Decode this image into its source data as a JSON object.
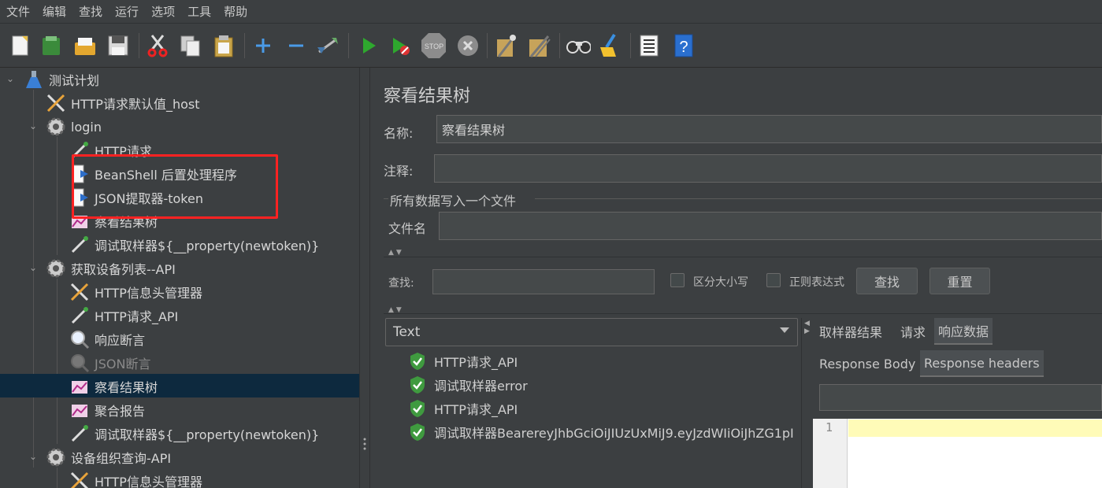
{
  "menu": [
    "文件",
    "编辑",
    "查找",
    "运行",
    "选项",
    "工具",
    "帮助"
  ],
  "toolbar_icons": [
    "new-icon",
    "templates-icon",
    "open-icon",
    "save-icon",
    "cut-icon",
    "copy-icon",
    "paste-icon",
    "expand-icon",
    "collapse-icon",
    "toggle-icon",
    "start-icon",
    "start-no-pause-icon",
    "stop-icon",
    "shutdown-icon",
    "clear-icon",
    "clear-all-icon",
    "search-icon",
    "reset-search-icon",
    "function-helper-icon",
    "help-icon"
  ],
  "tree": {
    "nodes": [
      {
        "label": "测试计划"
      },
      {
        "label": "HTTP请求默认值_host"
      },
      {
        "label": "login"
      },
      {
        "label": "HTTP请求"
      },
      {
        "label": "BeanShell 后置处理程序"
      },
      {
        "label": "JSON提取器-token"
      },
      {
        "label": "察看结果树"
      },
      {
        "label": "调试取样器${__property(newtoken)}"
      },
      {
        "label": "获取设备列表--API"
      },
      {
        "label": "HTTP信息头管理器"
      },
      {
        "label": "HTTP请求_API"
      },
      {
        "label": "响应断言"
      },
      {
        "label": "JSON断言"
      },
      {
        "label": "察看结果树"
      },
      {
        "label": "聚合报告"
      },
      {
        "label": "调试取样器${__property(newtoken)}"
      },
      {
        "label": "设备组织查询-API"
      },
      {
        "label": "HTTP信息头管理器"
      }
    ]
  },
  "panel": {
    "title": "察看结果树",
    "name_label": "名称:",
    "name_value": "察看结果树",
    "comment_label": "注释:",
    "comment_value": "",
    "file_group": "所有数据写入一个文件",
    "filename_label": "文件名",
    "filename_value": "",
    "search_label": "查找:",
    "search_value": "",
    "case_label": "区分大小写",
    "regex_label": "正则表达式",
    "find_button": "查找",
    "reset_button": "重置",
    "renderer": "Text"
  },
  "results": [
    {
      "label": "HTTP请求_API",
      "status": "success"
    },
    {
      "label": "调试取样器error",
      "status": "success"
    },
    {
      "label": "HTTP请求_API",
      "status": "success"
    },
    {
      "label": "调试取样器BearereyJhbGciOiJIUzUxMiJ9.eyJzdWIiOiJhZG1pI",
      "status": "success"
    }
  ],
  "tabs": {
    "top": [
      "取样器结果",
      "请求",
      "响应数据"
    ],
    "sub": [
      "Response Body",
      "Response headers"
    ]
  },
  "editor": {
    "line_number": "1"
  },
  "colors": {
    "background": "#3c3f41",
    "selection": "#0d293e",
    "highlight_box": "#ff2222",
    "success": "#3f9a3f"
  }
}
